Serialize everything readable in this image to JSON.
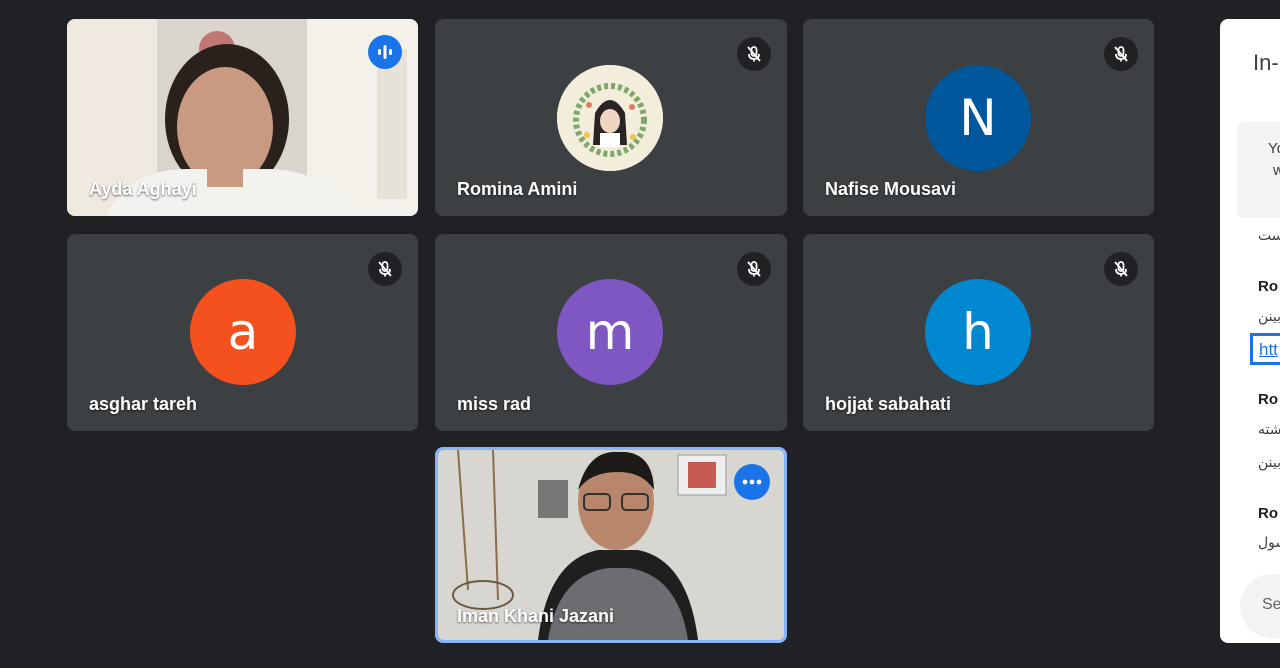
{
  "participants": [
    {
      "name": "Ayda Aghayi",
      "type": "video",
      "status": "speaking"
    },
    {
      "name": "Romina Amini",
      "type": "photo",
      "status": "muted"
    },
    {
      "name": "Nafise Mousavi",
      "type": "initial",
      "initial": "N",
      "color": "#01579b",
      "status": "muted"
    },
    {
      "name": "asghar tareh",
      "type": "initial",
      "initial": "a",
      "color": "#f4511e",
      "status": "muted"
    },
    {
      "name": "miss rad",
      "type": "initial",
      "initial": "m",
      "color": "#7e57c2",
      "status": "muted"
    },
    {
      "name": "hojjat sabahati",
      "type": "initial",
      "initial": "h",
      "color": "#0288d1",
      "status": "muted"
    },
    {
      "name": "Iman Khani Jazani",
      "type": "video",
      "status": "self"
    }
  ],
  "side_panel": {
    "title": "In-",
    "notice_line1": "Yo",
    "notice_line2": "w",
    "messages": [
      {
        "text": "ست"
      },
      {
        "sender": "Ro",
        "line1": "بینن",
        "link": "htt"
      },
      {
        "sender": "Ro",
        "line1": "شته",
        "line2": "بینن"
      },
      {
        "sender": "Ro",
        "line1": "سول"
      }
    ],
    "send_placeholder": "Se"
  },
  "colors": {
    "background": "#202124",
    "tile": "#3c4043",
    "accent": "#1a73e8"
  }
}
